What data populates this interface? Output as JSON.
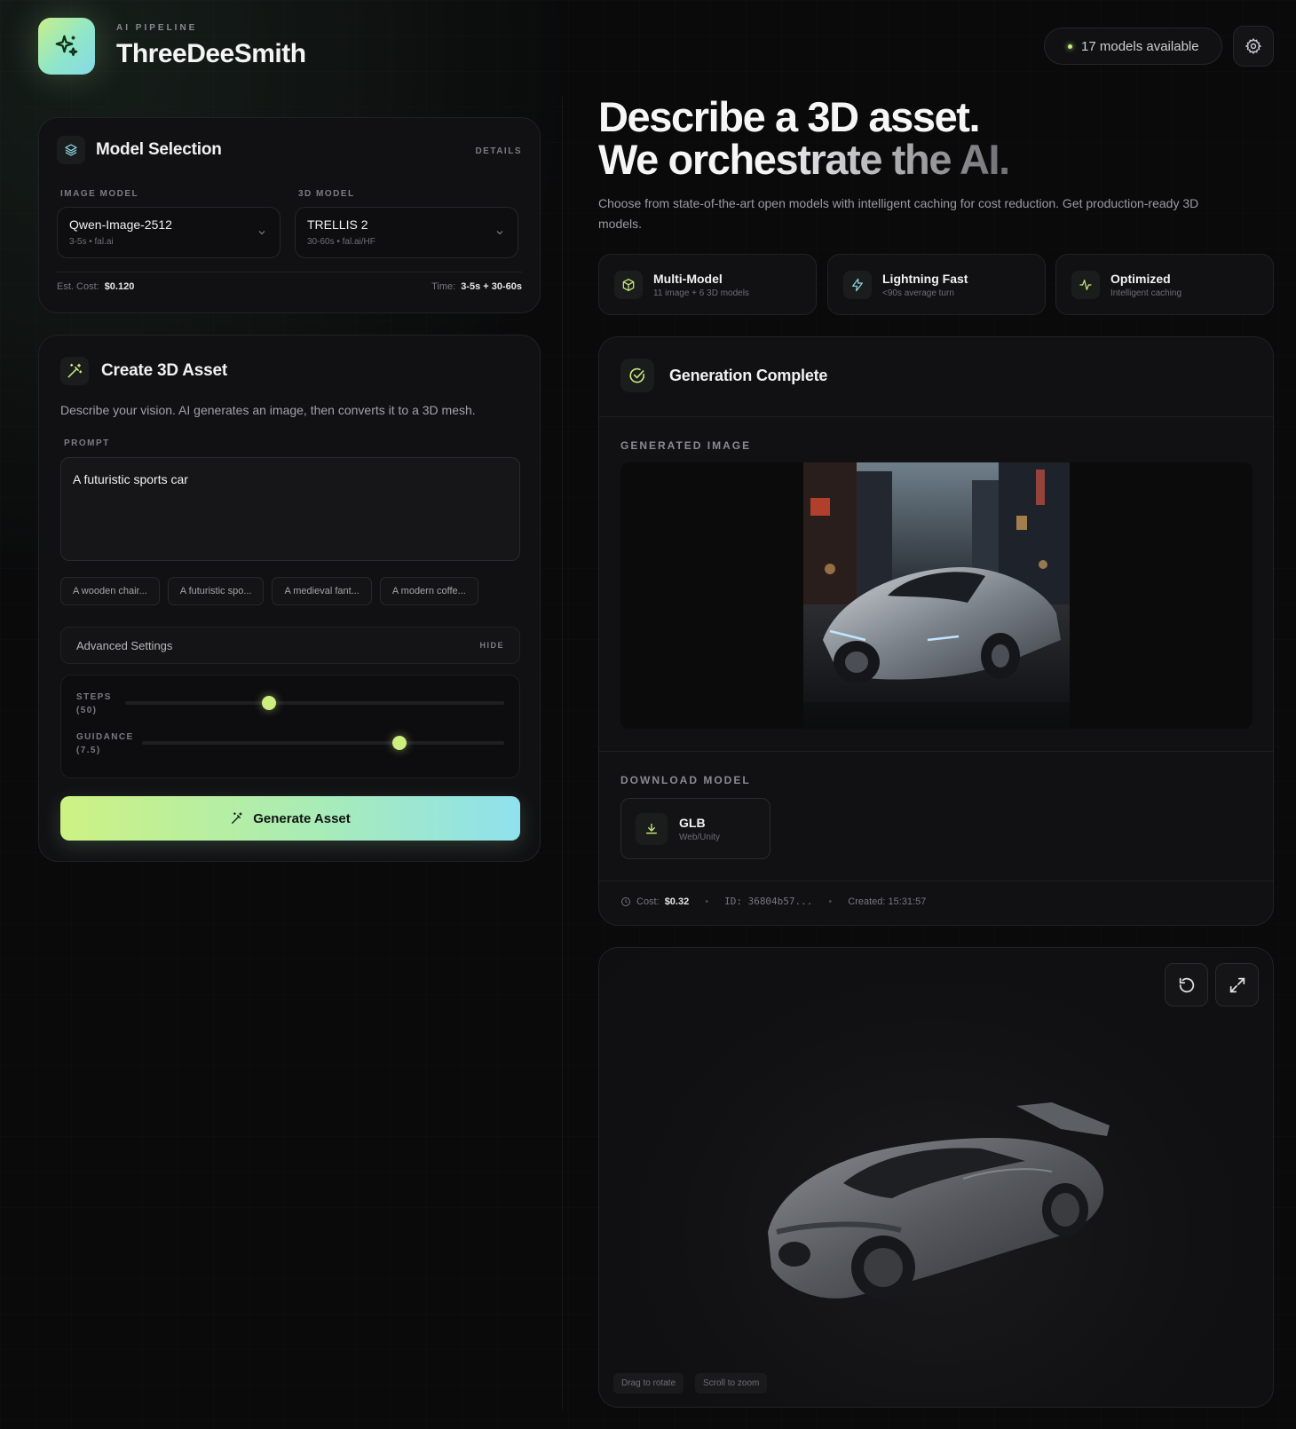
{
  "header": {
    "kicker": "AI PIPELINE",
    "title": "ThreeDeeSmith",
    "models_available": "17 models available",
    "logo_icon": "sparkles-icon",
    "settings_icon": "gear-icon"
  },
  "model_selection": {
    "title": "Model Selection",
    "details_label": "DETAILS",
    "image_model": {
      "label": "IMAGE MODEL",
      "value": "Qwen-Image-2512",
      "sub": "3-5s • fal.ai"
    },
    "model_3d": {
      "label": "3D MODEL",
      "value": "TRELLIS 2",
      "sub": "30-60s • fal.ai/HF"
    },
    "est_cost_label": "Est. Cost:",
    "est_cost_value": "$0.120",
    "time_label": "Time:",
    "time_value": "3-5s + 30-60s"
  },
  "create": {
    "title": "Create 3D Asset",
    "description": "Describe your vision. AI generates an image, then converts it to a 3D mesh.",
    "prompt_label": "PROMPT",
    "prompt_value": "A futuristic sports car",
    "suggestions": [
      "A wooden chair...",
      "A futuristic spo...",
      "A medieval fant...",
      "A modern coffe..."
    ],
    "advanced_label": "Advanced Settings",
    "advanced_toggle": "HIDE",
    "steps_label": "STEPS",
    "steps_value": "(50)",
    "steps_fraction": 0.38,
    "guidance_label": "GUIDANCE",
    "guidance_value": "(7.5)",
    "guidance_fraction": 0.71,
    "generate_label": "Generate Asset"
  },
  "hero": {
    "line1": "Describe a 3D asset.",
    "line2": "We orchestrate the AI.",
    "subtitle": "Choose from state-of-the-art open models with intelligent caching for cost reduction. Get production-ready 3D models."
  },
  "features": [
    {
      "title": "Multi-Model",
      "sub": "11 image + 6 3D models",
      "icon": "cube-icon"
    },
    {
      "title": "Lightning Fast",
      "sub": "<90s average turn",
      "icon": "lightning-icon"
    },
    {
      "title": "Optimized",
      "sub": "Intelligent caching",
      "icon": "activity-icon"
    }
  ],
  "result": {
    "title": "Generation Complete",
    "generated_image_label": "GENERATED IMAGE",
    "download_label": "DOWNLOAD MODEL",
    "download_format": "GLB",
    "download_sub": "Web/Unity",
    "cost_label": "Cost:",
    "cost_value": "$0.32",
    "id_text": "ID: 36804b57...",
    "created_text": "Created: 15:31:57"
  },
  "viewer": {
    "hint_rotate": "Drag to rotate",
    "hint_zoom": "Scroll to zoom",
    "reset_icon": "rotate-ccw-icon",
    "expand_icon": "expand-icon"
  },
  "colors": {
    "accent_lime": "#cdef7f",
    "accent_cyan": "#8fe1ee",
    "background": "#0a0a0b",
    "panel": "#111113"
  }
}
